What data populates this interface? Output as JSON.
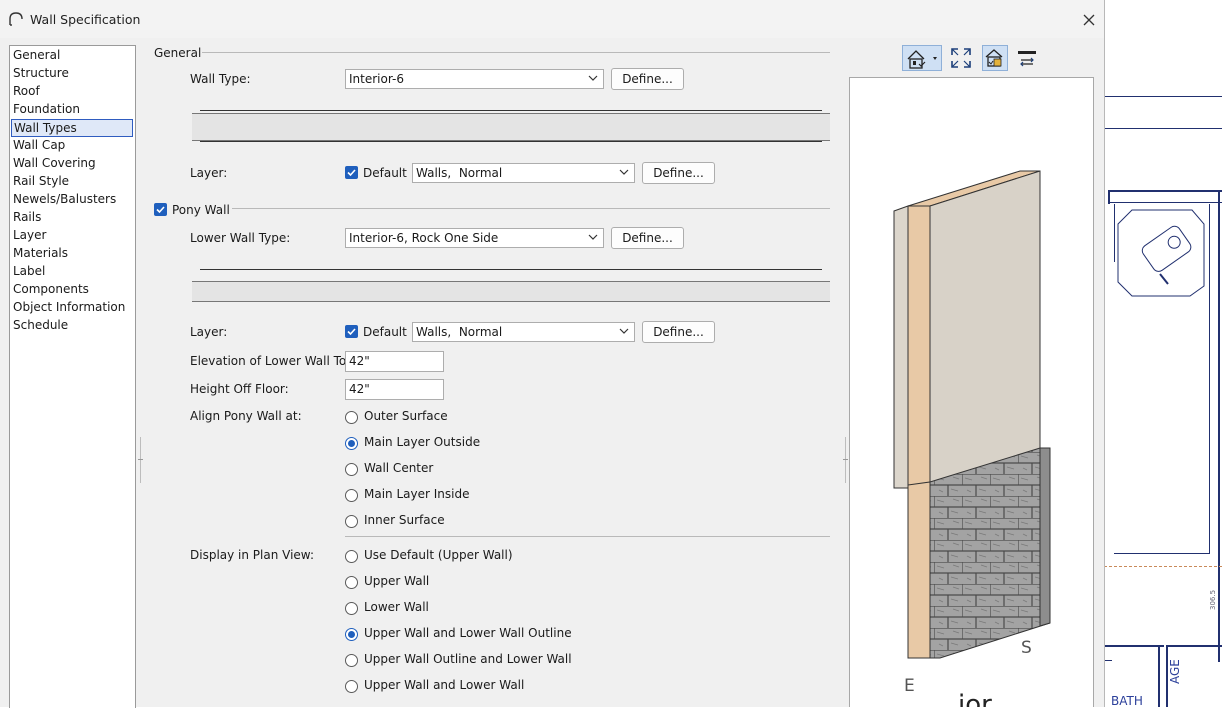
{
  "window": {
    "title": "Wall Specification"
  },
  "nav": {
    "items": [
      "General",
      "Structure",
      "Roof",
      "Foundation",
      "Wall Types",
      "Wall Cap",
      "Wall Covering",
      "Rail Style",
      "Newels/Balusters",
      "Rails",
      "Layer",
      "Materials",
      "Label",
      "Components",
      "Object Information",
      "Schedule"
    ],
    "selected": "Wall Types"
  },
  "general": {
    "group_label": "General",
    "wall_type_label": "Wall Type:",
    "wall_type_value": "Interior-6",
    "define_label": "Define...",
    "layer_label": "Layer:",
    "layer_default_label": "Default",
    "layer_default_checked": true,
    "layer_value": "Walls,  Normal"
  },
  "pony": {
    "checkbox_label": "Pony Wall",
    "checked": true,
    "lower_wall_type_label": "Lower Wall Type:",
    "lower_wall_type_value": "Interior-6, Rock One Side",
    "define_label": "Define...",
    "layer_label": "Layer:",
    "layer_default_label": "Default",
    "layer_value": "Walls,  Normal",
    "elevation_label": "Elevation of Lower Wall Top:",
    "elevation_value": "42\"",
    "height_label": "Height Off Floor:",
    "height_value": "42\"",
    "align_label": "Align Pony Wall at:",
    "align_options": [
      "Outer Surface",
      "Main Layer Outside",
      "Wall Center",
      "Main Layer Inside",
      "Inner Surface"
    ],
    "align_selected": "Main Layer Outside",
    "display_label": "Display in Plan View:",
    "display_options": [
      "Use Default (Upper Wall)",
      "Upper Wall",
      "Lower Wall",
      "Upper Wall and Lower Wall Outline",
      "Upper Wall Outline and Lower Wall",
      "Upper Wall and Lower Wall"
    ],
    "display_selected": "Upper Wall and Lower Wall Outline"
  },
  "preview": {
    "toolbar_icons": [
      "camera-view-icon",
      "fill-window-icon",
      "show-room-icon",
      "layer-toggle-icon"
    ],
    "compass_e": "E",
    "compass_s": "S"
  },
  "background": {
    "label_bath": "BATH",
    "label_age": "AGE",
    "dimension_text": "306.5"
  },
  "colors": {
    "accent": "#1f5fbd",
    "dialog_bg": "#f0f0f0",
    "plan_lines": "#21306f",
    "wall_upper": "#d8d2c8",
    "wall_edge": "#e7c9a7",
    "stone": "#9a9a9a"
  }
}
